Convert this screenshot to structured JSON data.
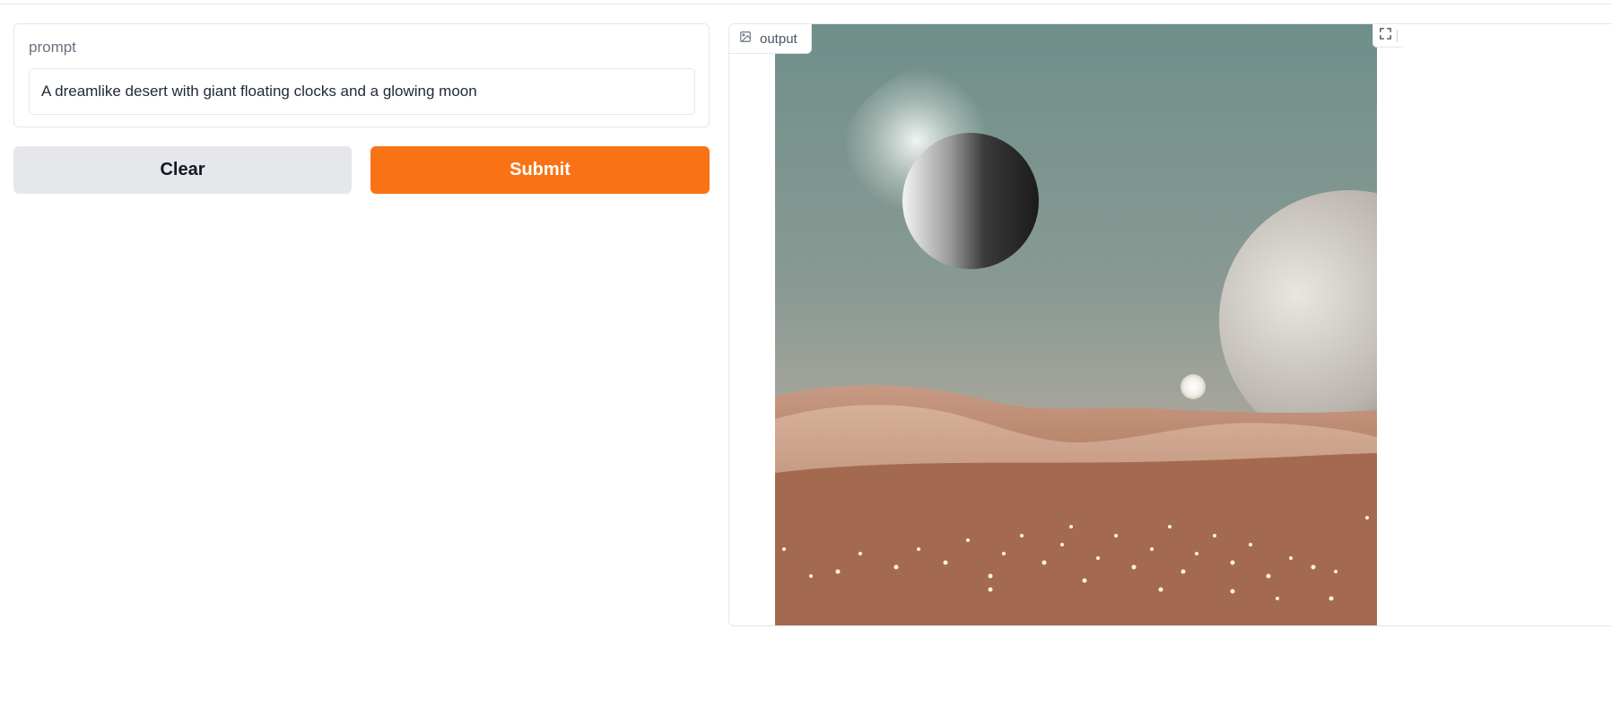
{
  "prompt": {
    "label": "prompt",
    "value": "A dreamlike desert with giant floating clocks and a glowing moon"
  },
  "buttons": {
    "clear": "Clear",
    "submit": "Submit"
  },
  "output": {
    "label": "output"
  },
  "colors": {
    "accent": "#f97316",
    "secondary_button": "#e5e7eb",
    "border": "#e5e7eb"
  },
  "icons": {
    "output": "image-icon",
    "fullscreen": "fullscreen-icon"
  }
}
